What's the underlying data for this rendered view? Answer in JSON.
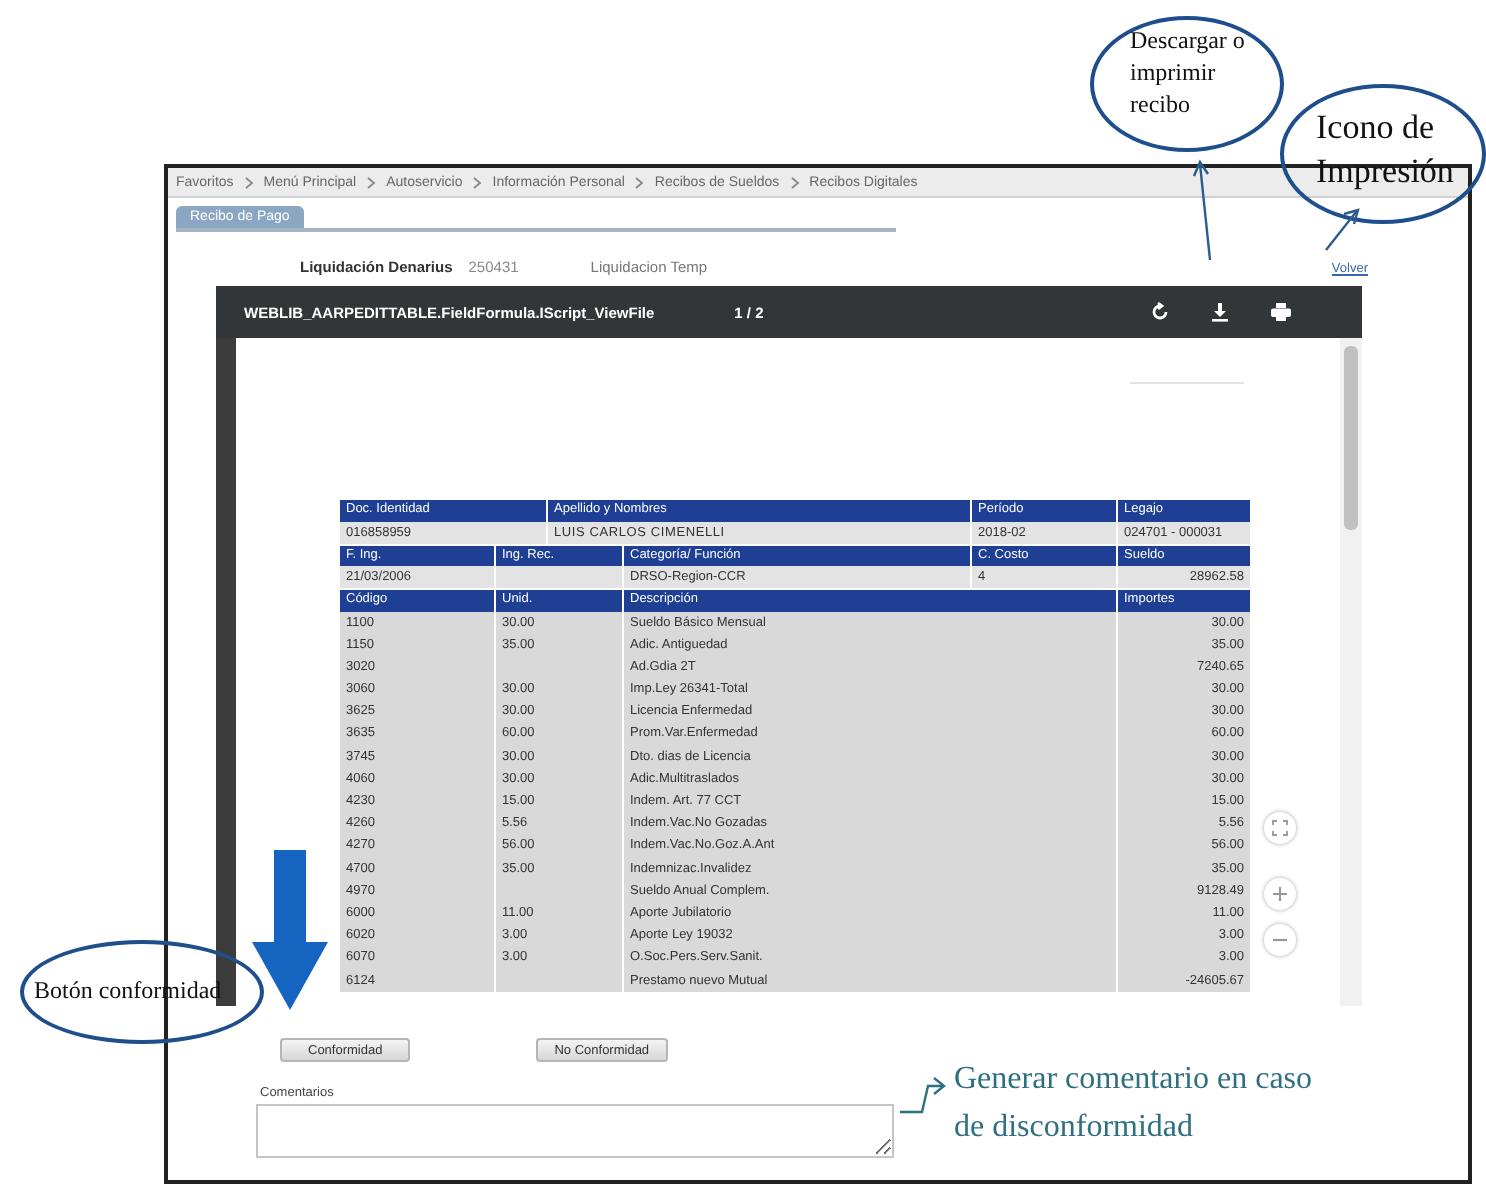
{
  "breadcrumb": [
    {
      "label": "Favoritos"
    },
    {
      "label": "Menú Principal"
    },
    {
      "label": "Autoservicio"
    },
    {
      "label": "Información Personal"
    },
    {
      "label": "Recibos de Sueldos"
    },
    {
      "label": "Recibos Digitales"
    }
  ],
  "tabs": [
    {
      "label": "Recibo de Pago",
      "selected": true
    }
  ],
  "summary": {
    "label": "Liquidación Denarius",
    "number": "250431",
    "description": "Liquidacion Temp"
  },
  "back_link": "Volver",
  "viewer": {
    "title": "WEBLIB_AARPEDITTABLE.FieldFormula.IScript_ViewFile",
    "page": "1 / 2"
  },
  "receipt": {
    "employee": [
      {
        "label": "Doc. Identidad",
        "value": "016858959"
      },
      {
        "label": "Apellido y Nombres",
        "value": "LUIS CARLOS CIMENELLI"
      },
      {
        "label": "Período",
        "value": "2018-02"
      },
      {
        "label": "Legajo",
        "value": "024701 - 000031"
      }
    ],
    "job": [
      {
        "label": "F. Ing.",
        "value": "21/03/2006"
      },
      {
        "label": "Ing. Rec."
      },
      {
        "label": "Categoría/ Función",
        "value": "DRSO-Region-CCR"
      },
      {
        "label": "C. Costo",
        "value": "4"
      },
      {
        "label": "Sueldo",
        "value": "28962.58"
      }
    ],
    "columns": [
      "Código",
      "Unid.",
      "Descripción",
      "Importes"
    ],
    "rows": [
      {
        "code": "1100",
        "units": "30.00",
        "description": "Sueldo Básico Mensual",
        "amount": "30.00"
      },
      {
        "code": "1150",
        "units": "35.00",
        "description": "Adic. Antiguedad",
        "amount": "35.00"
      },
      {
        "code": "3020",
        "description": "Ad.Gdia 2T",
        "amount": "7240.65"
      },
      {
        "code": "3060",
        "units": "30.00",
        "description": "Imp.Ley 26341-Total",
        "amount": "30.00"
      },
      {
        "code": "3625",
        "units": "30.00",
        "description": "Licencia Enfermedad",
        "amount": "30.00"
      },
      {
        "code": "3635",
        "units": "60.00",
        "description": "Prom.Var.Enfermedad",
        "amount": "60.00"
      },
      {
        "code": "3745",
        "units": "30.00",
        "description": "Dto. dias de Licencia",
        "amount": "30.00"
      },
      {
        "code": "4060",
        "units": "30.00",
        "description": "Adic.Multitraslados",
        "amount": "30.00"
      },
      {
        "code": "4230",
        "units": "15.00",
        "description": "Indem. Art. 77 CCT",
        "amount": "15.00"
      },
      {
        "code": "4260",
        "units": "5.56",
        "description": "Indem.Vac.No Gozadas",
        "amount": "5.56"
      },
      {
        "code": "4270",
        "units": "56.00",
        "description": "Indem.Vac.No.Goz.A.Ant",
        "amount": "56.00"
      },
      {
        "code": "4700",
        "units": "35.00",
        "description": "Indemnizac.Invalidez",
        "amount": "35.00"
      },
      {
        "code": "4970",
        "description": "Sueldo Anual Complem.",
        "amount": "9128.49"
      },
      {
        "code": "6000",
        "units": "11.00",
        "description": "Aporte Jubilatorio",
        "amount": "11.00"
      },
      {
        "code": "6020",
        "units": "3.00",
        "description": "Aporte Ley 19032",
        "amount": "3.00"
      },
      {
        "code": "6070",
        "units": "3.00",
        "description": "O.Soc.Pers.Serv.Sanit.",
        "amount": "3.00"
      },
      {
        "code": "6124",
        "description": "Prestamo nuevo Mutual",
        "amount": "-24605.67"
      }
    ]
  },
  "buttons": [
    "Conformidad",
    "No Conformidad"
  ],
  "comments": {
    "label": "Comentarios"
  },
  "callouts": [
    {
      "kind": "ellipse",
      "text": "Descargar o imprimir recibo"
    },
    {
      "kind": "ellipse",
      "text": "Icono de Impresión"
    },
    {
      "kind": "ellipse",
      "text": "Botón conformidad"
    },
    {
      "kind": "plain",
      "text": "Generar comentario en caso de disconformidad"
    }
  ]
}
